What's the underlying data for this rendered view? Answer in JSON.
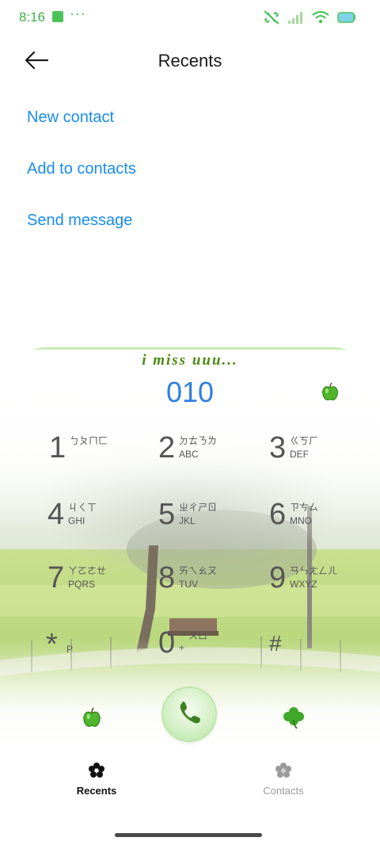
{
  "status_bar": {
    "time": "8:16",
    "dots": "···"
  },
  "header": {
    "title": "Recents"
  },
  "actions": [
    {
      "label": "New contact"
    },
    {
      "label": "Add to contacts"
    },
    {
      "label": "Send message"
    }
  ],
  "dialer": {
    "tagline": "i miss uuu...",
    "number": "010",
    "keys": [
      {
        "digit": "1",
        "bopomofo": "ㄅㄆㄇㄈ",
        "letters": ""
      },
      {
        "digit": "2",
        "bopomofo": "ㄉㄊㄋㄌ",
        "letters": "ABC"
      },
      {
        "digit": "3",
        "bopomofo": "ㄍㄎㄏ",
        "letters": "DEF"
      },
      {
        "digit": "4",
        "bopomofo": "ㄐㄑㄒ",
        "letters": "GHI"
      },
      {
        "digit": "5",
        "bopomofo": "ㄓㄔㄕㄖ",
        "letters": "JKL"
      },
      {
        "digit": "6",
        "bopomofo": "ㄗㄘㄙ",
        "letters": "MNO"
      },
      {
        "digit": "7",
        "bopomofo": "ㄚㄛㄜㄝ",
        "letters": "PQRS"
      },
      {
        "digit": "8",
        "bopomofo": "ㄞㄟㄠㄡ",
        "letters": "TUV"
      },
      {
        "digit": "9",
        "bopomofo": "ㄢㄣㄤㄥㄦ",
        "letters": "WXYZ"
      },
      {
        "digit": "*",
        "bopomofo": "",
        "letters": "P"
      },
      {
        "digit": "0",
        "bopomofo": "一ㄨㄩ",
        "letters": "+"
      },
      {
        "digit": "#",
        "bopomofo": "",
        "letters": ""
      }
    ]
  },
  "tabs": [
    {
      "label": "Recents",
      "active": true
    },
    {
      "label": "Contacts",
      "active": false
    }
  ],
  "colors": {
    "accent": "#1a8cf0",
    "dial_number": "#2f7fe0",
    "status_green": "#4cc35a",
    "tagline": "#4a8a12"
  },
  "icons": [
    "back-arrow-icon",
    "apple-icon",
    "phone-icon",
    "clover-icon",
    "recents-flower-icon",
    "contacts-flower-icon"
  ]
}
